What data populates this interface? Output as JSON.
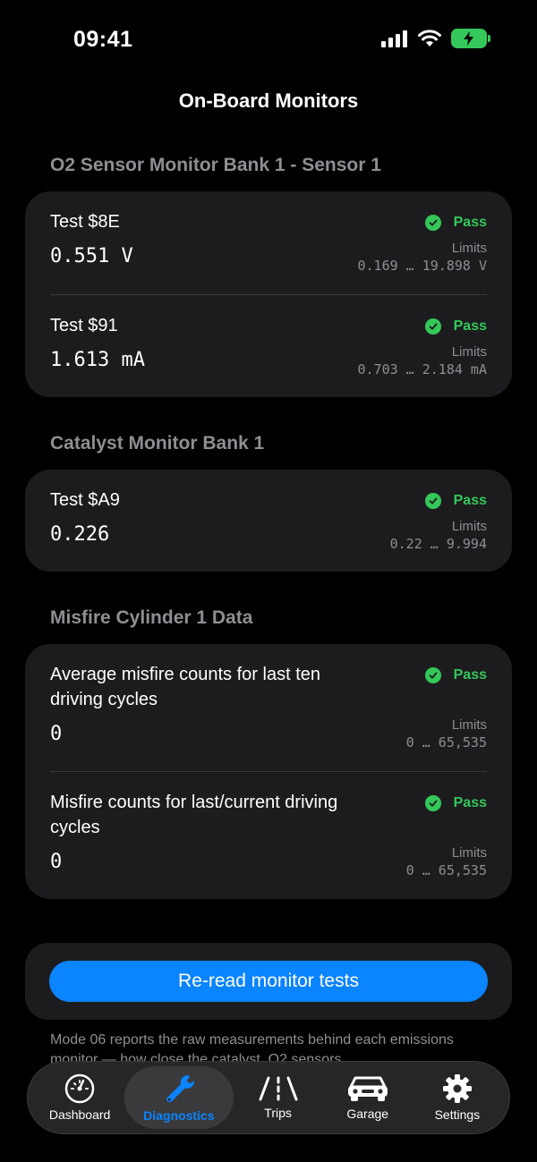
{
  "status_bar": {
    "time": "09:41"
  },
  "nav": {
    "title": "On-Board Monitors"
  },
  "sections": [
    {
      "title": "O2 Sensor Monitor Bank 1 - Sensor 1",
      "tests": [
        {
          "name": "Test $8E",
          "value": "0.551 V",
          "status": "Pass",
          "limits_label": "Limits",
          "limits": "0.169 … 19.898 V"
        },
        {
          "name": "Test $91",
          "value": "1.613 mA",
          "status": "Pass",
          "limits_label": "Limits",
          "limits": "0.703 … 2.184 mA"
        }
      ]
    },
    {
      "title": "Catalyst Monitor Bank 1",
      "tests": [
        {
          "name": "Test $A9",
          "value": "0.226",
          "status": "Pass",
          "limits_label": "Limits",
          "limits": "0.22 … 9.994"
        }
      ]
    },
    {
      "title": "Misfire Cylinder 1 Data",
      "tests": [
        {
          "name": "Average misfire counts for last ten driving cycles",
          "value": "0",
          "status": "Pass",
          "limits_label": "Limits",
          "limits": "0 … 65,535"
        },
        {
          "name": "Misfire counts for last/current driving cycles",
          "value": "0",
          "status": "Pass",
          "limits_label": "Limits",
          "limits": "0 … 65,535"
        }
      ]
    }
  ],
  "actions": {
    "reread_label": "Re-read monitor tests"
  },
  "footnote": "Mode 06 reports the raw measurements behind each emissions monitor — how close the catalyst, O2 sensors",
  "tab_bar": {
    "tabs": [
      {
        "label": "Dashboard",
        "icon": "gauge-icon"
      },
      {
        "label": "Diagnostics",
        "icon": "wrench-icon",
        "active": true
      },
      {
        "label": "Trips",
        "icon": "road-icon"
      },
      {
        "label": "Garage",
        "icon": "car-icon"
      },
      {
        "label": "Settings",
        "icon": "gear-icon"
      }
    ]
  },
  "colors": {
    "accent": "#0a84ff",
    "pass": "#34c759",
    "card": "#1c1c1e",
    "secondary_text": "#8e8e93"
  }
}
